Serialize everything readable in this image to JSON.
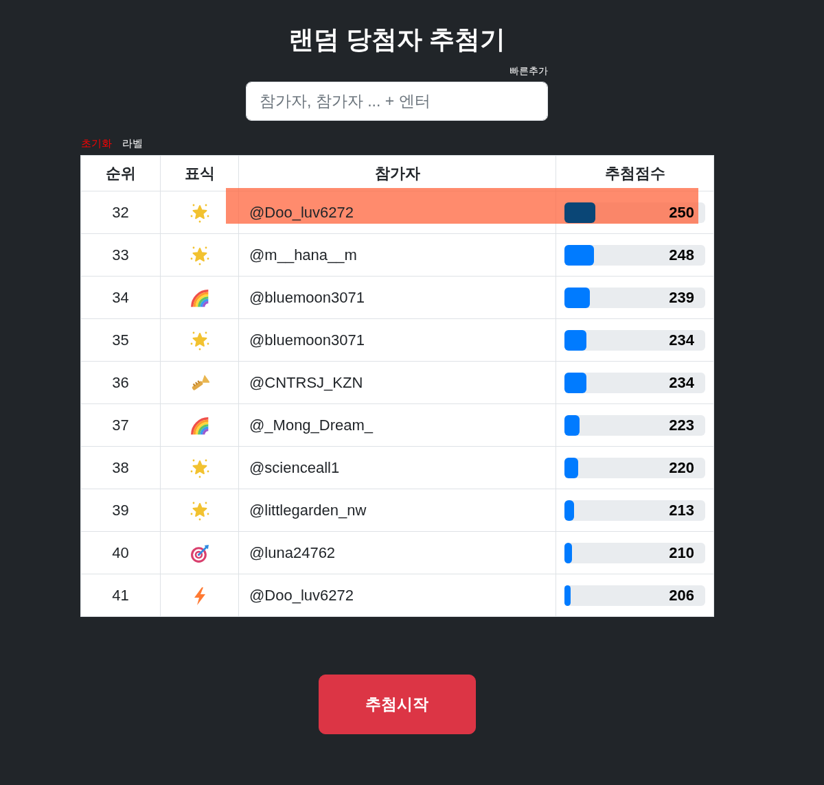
{
  "title": "랜덤 당첨자 추첨기",
  "quick_add": {
    "label": "빠른추가",
    "placeholder": "참가자, 참가자 ... + 엔터"
  },
  "actions": [
    {
      "label": "초기화",
      "kind": "reset"
    },
    {
      "label": "라벨",
      "kind": "plain"
    }
  ],
  "table": {
    "columns": [
      "순위",
      "표식",
      "참가자",
      "추첨점수"
    ],
    "rows": [
      {
        "rank": "32",
        "kind": "star",
        "name": "@Doo_luv6272",
        "score": "250",
        "level": 0.22,
        "highlighted": true
      },
      {
        "rank": "33",
        "kind": "star",
        "name": "@m__hana__m",
        "score": "248",
        "level": 0.21,
        "highlighted": false
      },
      {
        "rank": "34",
        "kind": "rainbow",
        "name": "@bluemoon3071",
        "score": "239",
        "level": 0.18,
        "highlighted": false
      },
      {
        "rank": "35",
        "kind": "star",
        "name": "@bluemoon3071",
        "score": "234",
        "level": 0.155,
        "highlighted": false
      },
      {
        "rank": "36",
        "kind": "trumpet",
        "name": "@CNTRSJ_KZN",
        "score": "234",
        "level": 0.155,
        "highlighted": false
      },
      {
        "rank": "37",
        "kind": "rainbow",
        "name": "@_Mong_Dream_",
        "score": "223",
        "level": 0.105,
        "highlighted": false
      },
      {
        "rank": "38",
        "kind": "star",
        "name": "@scienceall1",
        "score": "220",
        "level": 0.097,
        "highlighted": false
      },
      {
        "rank": "39",
        "kind": "star",
        "name": "@littlegarden_nw",
        "score": "213",
        "level": 0.068,
        "highlighted": false
      },
      {
        "rank": "40",
        "kind": "target",
        "name": "@luna24762",
        "score": "210",
        "level": 0.054,
        "highlighted": false
      },
      {
        "rank": "41",
        "kind": "bolt",
        "name": "@Doo_luv6272",
        "score": "206",
        "level": 0.044,
        "highlighted": false
      }
    ]
  },
  "start_button": "추첨시작"
}
